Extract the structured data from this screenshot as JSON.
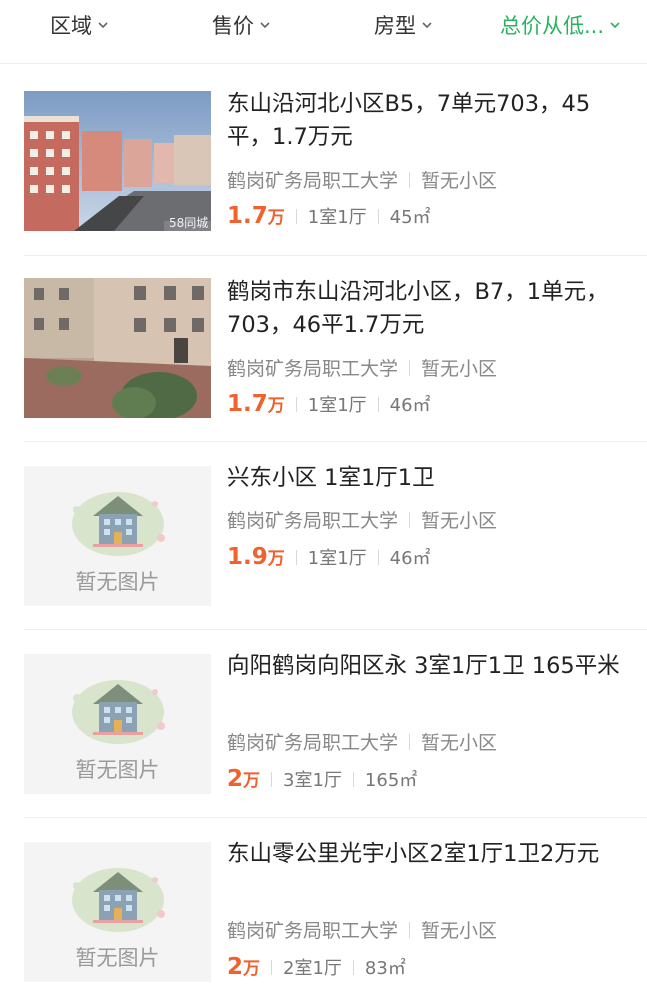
{
  "filters": [
    {
      "label": "区域",
      "active": false
    },
    {
      "label": "售价",
      "active": false
    },
    {
      "label": "房型",
      "active": false
    },
    {
      "label": "总价从低...",
      "active": true
    }
  ],
  "colors": {
    "accent_green": "#2bb25f",
    "price_orange": "#f0612d"
  },
  "listings": [
    {
      "title": "东山沿河北小区B5，7单元703，45平，1.7万元",
      "location": "鹤岗矿务局职工大学",
      "community": "暂无小区",
      "price": "1.7",
      "price_unit": "万",
      "layout": "1室1厅",
      "area": "45㎡",
      "image": "photo-apartment-blocks",
      "watermark": "58同城"
    },
    {
      "title": "鹤岗市东山沿河北小区，B7，1单元，703，46平1.7万元",
      "location": "鹤岗矿务局职工大学",
      "community": "暂无小区",
      "price": "1.7",
      "price_unit": "万",
      "layout": "1室1厅",
      "area": "46㎡",
      "image": "photo-courtyard"
    },
    {
      "title": "兴东小区 1室1厅1卫",
      "location": "鹤岗矿务局职工大学",
      "community": "暂无小区",
      "price": "1.9",
      "price_unit": "万",
      "layout": "1室1厅",
      "area": "46㎡",
      "image": "no-image-placeholder",
      "placeholder_text": "暂无图片"
    },
    {
      "title": "向阳鹤岗向阳区永 3室1厅1卫 165平米",
      "location": "鹤岗矿务局职工大学",
      "community": "暂无小区",
      "price": "2",
      "price_unit": "万",
      "layout": "3室1厅",
      "area": "165㎡",
      "image": "no-image-placeholder",
      "placeholder_text": "暂无图片"
    },
    {
      "title": "东山零公里光宇小区2室1厅1卫2万元",
      "location": "鹤岗矿务局职工大学",
      "community": "暂无小区",
      "price": "2",
      "price_unit": "万",
      "layout": "2室1厅",
      "area": "83㎡",
      "image": "no-image-placeholder",
      "placeholder_text": "暂无图片"
    }
  ]
}
